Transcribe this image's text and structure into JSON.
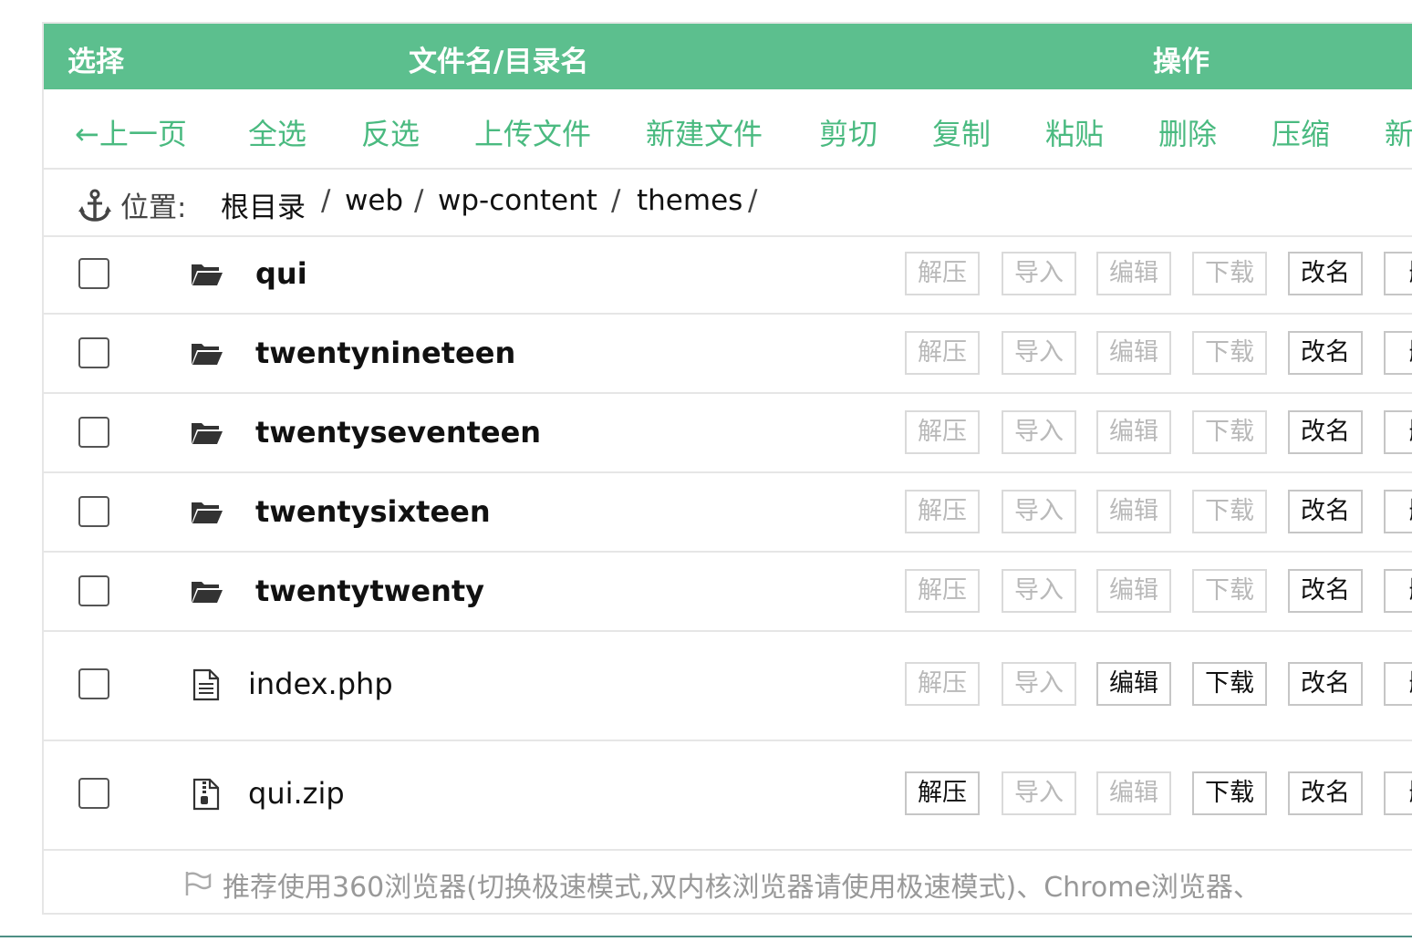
{
  "header": {
    "select_label": "选择",
    "name_label": "文件名/目录名",
    "ops_label": "操作"
  },
  "toolbar": {
    "items": [
      "←上一页",
      "全选",
      "反选",
      "上传文件",
      "新建文件",
      "剪切",
      "复制",
      "粘贴",
      "删除",
      "压缩",
      "新"
    ]
  },
  "breadcrumb": {
    "label": "位置:",
    "items": [
      "根目录",
      "web",
      "wp-content",
      "themes"
    ],
    "separator": "/"
  },
  "files": [
    {
      "name": "qui",
      "type": "folder"
    },
    {
      "name": "twentynineteen",
      "type": "folder"
    },
    {
      "name": "twentyseventeen",
      "type": "folder"
    },
    {
      "name": "twentysixteen",
      "type": "folder"
    },
    {
      "name": "twentytwenty",
      "type": "folder"
    },
    {
      "name": "index.php",
      "type": "file"
    },
    {
      "name": "qui.zip",
      "type": "zip"
    }
  ],
  "actions": {
    "unzip": "解压",
    "import": "导入",
    "edit": "编辑",
    "download": "下载",
    "rename": "改名",
    "delete": "删"
  },
  "notice": "推荐使用360浏览器(切换极速模式,双内核浏览器请使用极速模式)、Chrome浏览器、",
  "colors": {
    "accent": "#5cbf8e",
    "link": "#4aba80"
  }
}
